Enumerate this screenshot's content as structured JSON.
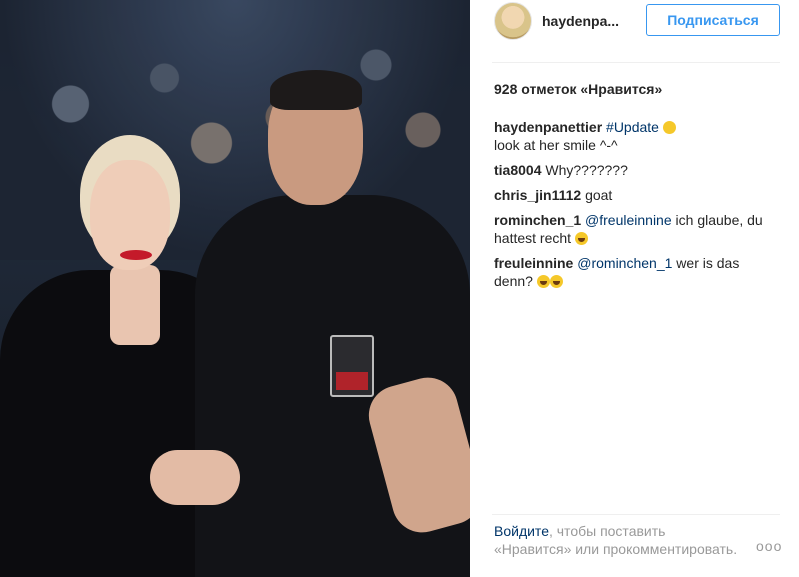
{
  "header": {
    "username": "hayden​pa...",
    "follow_label": "Подписаться"
  },
  "likes_text": "928 отметок «Нравится»",
  "comments": [
    {
      "author": "haydenpanettier",
      "mention": "#Update",
      "text_after": "",
      "line2": "look at her smile ^-^",
      "emoji": "smile"
    },
    {
      "author": "tia8004",
      "text": "Why???????"
    },
    {
      "author": "chris_jin1112",
      "text": "goat"
    },
    {
      "author": "rominchen_1",
      "mention": "@freuleinnine",
      "text": "ich glaube, du hattest recht",
      "emoji": "laugh"
    },
    {
      "author": "freuleinnine",
      "mention": "@rominchen_1",
      "text": "wer is das denn?",
      "emoji": "laugh-laugh"
    }
  ],
  "footer": {
    "login_label": "Войдите",
    "text": ", чтобы поставить «Нравится» или прокомментировать."
  },
  "more_icon": "ooo",
  "colors": {
    "accent": "#3897f0",
    "link": "#003569",
    "muted": "#999999"
  }
}
